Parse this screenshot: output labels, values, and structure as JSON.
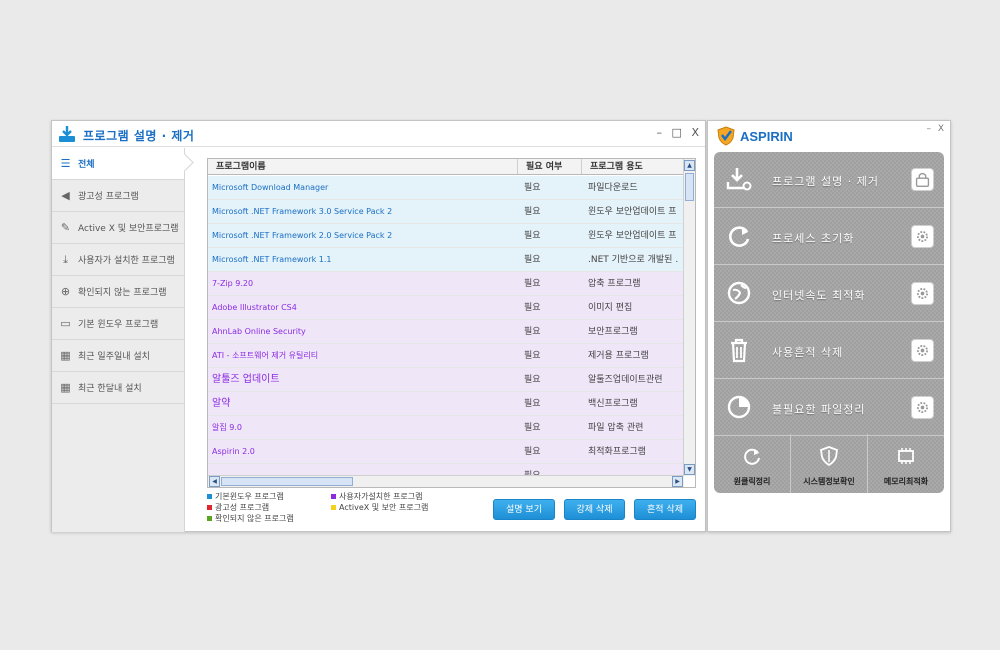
{
  "main": {
    "title": "프로그램 설명 · 제거",
    "controls": {
      "minimize": "–",
      "maximize": "□",
      "close": "X"
    }
  },
  "sidebar": {
    "items": [
      {
        "label": "전체",
        "icon": "list-icon"
      },
      {
        "label": "광고성 프로그램",
        "icon": "speaker-icon"
      },
      {
        "label": "Active X 및 보안프로그램",
        "icon": "wrench-icon"
      },
      {
        "label": "사용자가 설치한 프로그램",
        "icon": "download-icon"
      },
      {
        "label": "확인되지 않는 프로그램",
        "icon": "crosshair-icon"
      },
      {
        "label": "기본 윈도우 프로그램",
        "icon": "monitor-icon"
      },
      {
        "label": "최근 일주일내 설치",
        "icon": "calendar-icon"
      },
      {
        "label": "최근 한달내 설치",
        "icon": "calendar-icon"
      }
    ]
  },
  "table": {
    "columns": [
      "프로그램이름",
      "필요 여부",
      "프로그램 용도"
    ],
    "rows": [
      {
        "name": "Microsoft Download Manager",
        "need": "필요",
        "use": "파일다운로드",
        "cat": "basic"
      },
      {
        "name": "Microsoft .NET Framework 3.0 Service Pack 2",
        "need": "필요",
        "use": "윈도우 보안업데이트 프",
        "cat": "basic"
      },
      {
        "name": "Microsoft .NET Framework 2.0 Service Pack 2",
        "need": "필요",
        "use": "윈도우 보안업데이트 프",
        "cat": "basic"
      },
      {
        "name": "Microsoft .NET Framework 1.1",
        "need": "필요",
        "use": ".NET 기반으로 개발된 .",
        "cat": "basic"
      },
      {
        "name": "7-Zip 9.20",
        "need": "필요",
        "use": "압축 프로그램",
        "cat": "user"
      },
      {
        "name": "Adobe Illustrator CS4",
        "need": "필요",
        "use": "이미지 편집",
        "cat": "user"
      },
      {
        "name": "AhnLab Online Security",
        "need": "필요",
        "use": "보안프로그램",
        "cat": "user"
      },
      {
        "name": "ATI - 소프트웨어 제거 유틸리티",
        "need": "필요",
        "use": "제거용 프로그램",
        "cat": "user"
      },
      {
        "name": "알툴즈 업데이트",
        "need": "필요",
        "use": "알툴즈업데이트관련",
        "cat": "user",
        "big": true
      },
      {
        "name": "알약",
        "need": "필요",
        "use": "백신프로그램",
        "cat": "user",
        "big": true
      },
      {
        "name": "알집 9.0",
        "need": "필요",
        "use": "파일 압축 관련",
        "cat": "user"
      },
      {
        "name": "Aspirin 2.0",
        "need": "필요",
        "use": "최적화프로그램",
        "cat": "user"
      },
      {
        "name": "...",
        "need": "필요",
        "use": "...",
        "cat": "user"
      }
    ]
  },
  "legend": [
    {
      "label": "기본윈도우 프로그램",
      "color": "#1a8fd6"
    },
    {
      "label": "사용자가설치한 프로그램",
      "color": "#8a2be2"
    },
    {
      "label": "광고성 프로그램",
      "color": "#e0262b"
    },
    {
      "label": "ActiveX 및 보안 프로그램",
      "color": "#f2d21b"
    },
    {
      "label": "확인되지 않은 프로그램",
      "color": "#5aa51f"
    }
  ],
  "buttons": {
    "view_desc": "설명 보기",
    "force_delete": "강제 삭제",
    "trace_delete": "흔적 삭제"
  },
  "aspirin": {
    "title": "ASPIRIN",
    "controls": {
      "minimize": "–",
      "close": "X"
    },
    "menu": [
      {
        "label": "프로그램 설명 · 제거"
      },
      {
        "label": "프로세스 초기화"
      },
      {
        "label": "인터넷속도 최적화"
      },
      {
        "label": "사용흔적 삭제"
      },
      {
        "label": "불필요한 파일정리"
      }
    ],
    "bottom": [
      {
        "label": "원클릭정리",
        "icon": "refresh-icon"
      },
      {
        "label": "시스템정보확인",
        "icon": "shield-icon"
      },
      {
        "label": "메모리최적화",
        "icon": "chip-icon"
      }
    ]
  }
}
